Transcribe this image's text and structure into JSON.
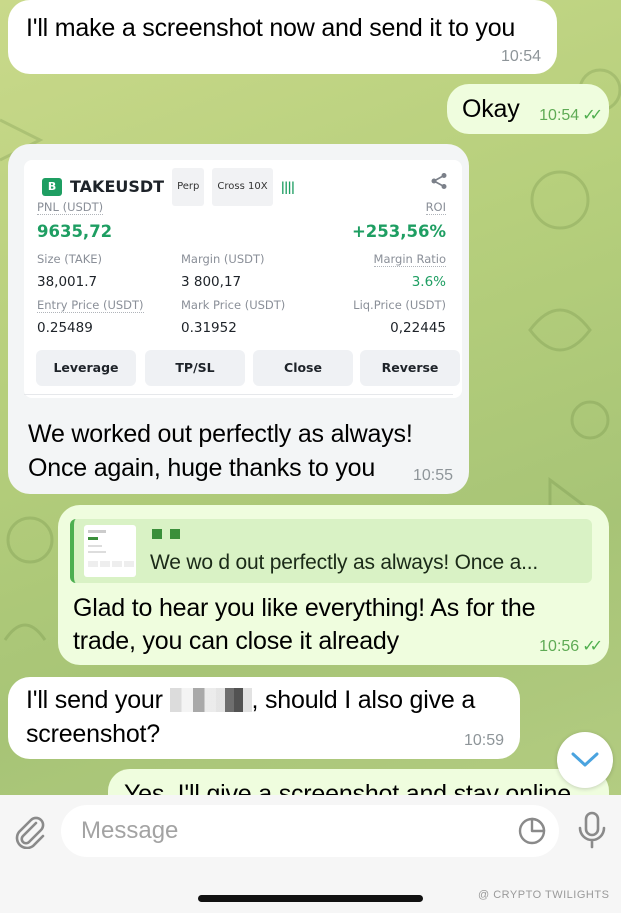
{
  "messages": [
    {
      "text": "I'll make a screenshot now and send it to you",
      "time": "10:54"
    },
    {
      "text": "Okay",
      "time": "10:54"
    },
    {
      "trade_card": {
        "coin_badge": "B",
        "symbol": "TAKEUSDT",
        "tag_perp": "Perp",
        "tag_cross": "Cross 10X",
        "pnl_label": "PNL (USDT)",
        "pnl_value": "9635,72",
        "roi_label": "ROI",
        "roi_value": "+253,56%",
        "size_label": "Size (TAKE)",
        "size_value": "38,001.7",
        "margin_label": "Margin (USDT)",
        "margin_value": "3 800,17",
        "margin_ratio_label": "Margin Ratio",
        "margin_ratio_value": "3.6%",
        "entry_label": "Entry Price (USDT)",
        "entry_value": "0.25489",
        "mark_label": "Mark Price (USDT)",
        "mark_value": "0.31952",
        "liq_label": "Liq.Price (USDT)",
        "liq_value": "0,22445",
        "buttons": [
          "Leverage",
          "TP/SL",
          "Close",
          "Reverse"
        ]
      },
      "text_line1": "We worked out perfectly as always!",
      "text_line2": "Once again, huge thanks to you",
      "time": "10:55"
    },
    {
      "reply_preview": "We wo    d out perfectly as always! Once a...",
      "text_line1": "Glad to hear you like everything! As for the",
      "text_line2": "trade, you can close it already",
      "time": "10:56"
    },
    {
      "text_line1_start": "I'll send your",
      "text_line1_end": ", should I also give a",
      "text_line2": "screenshot?",
      "time": "10:59"
    },
    {
      "text": "Yes, I'll give a screenshot and stay online"
    }
  ],
  "input": {
    "placeholder": "Message"
  },
  "watermark": "@ CRYPTO TWILIGHTS",
  "colors": {
    "incoming": "#ffffff",
    "outgoing": "#effdde",
    "accent_green": "#1e9e62",
    "read_check": "#4fae4e"
  },
  "icons": [
    "attach-icon",
    "sticker-icon",
    "mic-icon",
    "chevron-down-icon",
    "share-icon",
    "double-check-icon"
  ]
}
